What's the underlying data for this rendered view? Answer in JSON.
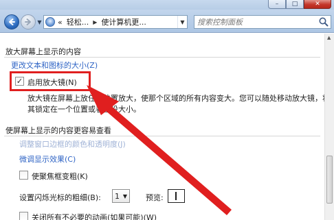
{
  "titlebar": {
    "minimize_symbol": "–",
    "maximize_symbol": "□",
    "close_symbol": "✕"
  },
  "nav": {
    "address_prefix": "«",
    "address_segments": [
      "轻松...",
      "使计算机更..."
    ],
    "search_placeholder": "搜索控制面板"
  },
  "section1": {
    "heading": "放大屏幕上显示的内容",
    "link": "更改文本和图标的大小(Z)",
    "checkbox_label": "启用放大镜(N)",
    "checkbox_checked": true,
    "checkbox_mark": "✓",
    "description_line1": "放大镜在屏幕上放任何位置放大，使那个区域的所有内容变大。您可以随处移动放大镜，将",
    "description_line2": "其锁定在一个位置或者重设大小。"
  },
  "section2": {
    "heading": "使屏幕上显示的内容更容易查看",
    "link_disabled": "调整窗口边框的颜色和透明度(J)",
    "link": "微调显示效果(C)",
    "focus_checkbox_label": "使聚焦框变粗(K)",
    "focus_checkbox_checked": false,
    "cursor_label": "设置闪烁光标的粗细(B):",
    "cursor_value": "1",
    "preview_label": "预览:",
    "animations_checkbox_label": "关闭所有不必要的动画(如果可能)(W)",
    "animations_checkbox_checked": false
  },
  "annotation": {
    "highlight_color": "#e01f1f",
    "arrow_color": "#e01f1f"
  }
}
